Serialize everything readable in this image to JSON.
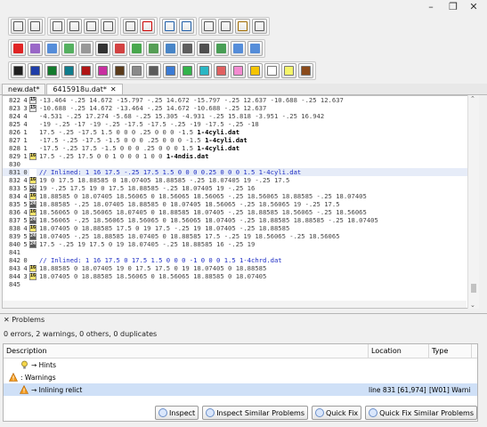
{
  "window": {
    "minimize": "–",
    "maximize": "❐",
    "close": "✕"
  },
  "toolbar": {
    "row1": [
      [
        "icon-new",
        "#555"
      ],
      [
        "icon-mirror",
        "#555"
      ],
      [
        "icon-grid1",
        "#555"
      ],
      [
        "icon-grid2",
        "#555"
      ],
      [
        "icon-grid3",
        "#555"
      ],
      [
        "icon-grid4",
        "#555"
      ],
      [
        "icon-cloud",
        "#555"
      ],
      [
        "icon-block",
        "#c00"
      ],
      [
        "icon-undo",
        "#1e5ea8"
      ],
      [
        "icon-redo",
        "#1e5ea8"
      ],
      [
        "icon-cut",
        "#555"
      ],
      [
        "icon-copy",
        "#555"
      ],
      [
        "icon-paste",
        "#a06b00"
      ],
      [
        "icon-delete",
        "#555"
      ]
    ],
    "row2": [
      [
        "icon-stop",
        "#d00"
      ],
      [
        "icon-edit",
        "#8a4fc0"
      ],
      [
        "icon-colors",
        "#3a7bd5"
      ],
      [
        "icon-puzzle",
        "#3aa546"
      ],
      [
        "icon-gear",
        "#888"
      ],
      [
        "icon-3d",
        "#111"
      ],
      [
        "icon-brick",
        "#c22"
      ],
      [
        "icon-ball",
        "#2a9a30"
      ],
      [
        "icon-rotate",
        "#3a8f3a"
      ],
      [
        "icon-move",
        "#2a72c0"
      ],
      [
        "icon-sync",
        "#444"
      ],
      [
        "icon-dup",
        "#333"
      ],
      [
        "icon-tag",
        "#2a8f3a"
      ],
      [
        "icon-text1",
        "#3a7bd5"
      ],
      [
        "icon-text2",
        "#3a7bd5"
      ]
    ],
    "row3_colors": [
      "#1f1f1f",
      "#1e3da8",
      "#127a2c",
      "#0e7c8c",
      "#b01414",
      "#c82fa0",
      "#5a3a1a",
      "#8a8a8a",
      "#5a5a5a",
      "#3a7bd5",
      "#32b34a",
      "#2ab7c4",
      "#e06060",
      "#f38ad0",
      "#f5c400",
      "#ffffff",
      "#f5f56a",
      "#8a4a1a"
    ]
  },
  "tabs": [
    {
      "label": "new.dat*",
      "active": false,
      "close": ""
    },
    {
      "label": "6415918u.dat*",
      "active": true,
      "close": "✕"
    }
  ],
  "editor": {
    "lines": [
      {
        "num": "822",
        "type": "4",
        "icon": "15",
        "icon_bg": "#e8e8e8",
        "text": "-13.464 -.25 14.672 -15.797 -.25 14.672 -15.797 -.25 12.637 -10.688 -.25 12.637",
        "bold": "",
        "comment": false,
        "current": false
      },
      {
        "num": "823",
        "type": "3",
        "icon": "15",
        "icon_bg": "#e8e8e8",
        "text": "-10.688 -.25 14.672 -13.464 -.25 14.672 -10.688 -.25 12.637",
        "bold": "",
        "comment": false,
        "current": false
      },
      {
        "num": "824",
        "type": "4",
        "icon": "",
        "icon_bg": "#ffffff",
        "text": "-4.531 -.25 17.274 -5.68 -.25 15.305 -4.931 -.25 15.818 -3.951 -.25 16.942",
        "bold": "",
        "comment": false,
        "current": false
      },
      {
        "num": "825",
        "type": "4",
        "icon": "",
        "icon_bg": "#ffffff",
        "text": "-19 -.25 -17 -19 -.25 -17.5 -17.5 -.25 -19 -17.5 -.25 -18",
        "bold": "",
        "comment": false,
        "current": false
      },
      {
        "num": "826",
        "type": "1",
        "icon": "",
        "icon_bg": "#ffffff",
        "text": "17.5 -.25 -17.5 1.5 0 0 0 .25 0 0 0 -1.5 ",
        "bold": "1-4cyli.dat",
        "comment": false,
        "current": false
      },
      {
        "num": "827",
        "type": "1",
        "icon": "",
        "icon_bg": "#ffffff",
        "text": "-17.5 -.25 -17.5 -1.5 0 0 0 .25 0 0 0 -1.5 ",
        "bold": "1-4cyli.dat",
        "comment": false,
        "current": false
      },
      {
        "num": "828",
        "type": "1",
        "icon": "",
        "icon_bg": "#ffffff",
        "text": "-17.5 -.25 17.5 -1.5 0 0 0 .25 0 0 0 1.5 ",
        "bold": "1-4cyli.dat",
        "comment": false,
        "current": false
      },
      {
        "num": "829",
        "type": "1",
        "icon": "16",
        "icon_bg": "#f5e36b",
        "text": "17.5 -.25 17.5 0 0 1 0 0 0 1 0 0 ",
        "bold": "1-4ndis.dat",
        "comment": false,
        "current": false
      },
      {
        "num": "830",
        "type": "",
        "icon": "",
        "icon_bg": "#ffffff",
        "text": "",
        "bold": "",
        "comment": false,
        "current": false
      },
      {
        "num": "831",
        "type": "0",
        "icon": "",
        "icon_bg": "#ffffff",
        "text": "// Inlined: 1 16 17.5 -.25 17.5 1.5 0 0 0 0.25 0 0 0 1.5 1-4cyli.dat",
        "bold": "",
        "comment": true,
        "current": true
      },
      {
        "num": "832",
        "type": "4",
        "icon": "16",
        "icon_bg": "#f5e36b",
        "text": "19 0 17.5 18.88585 0 18.07405 18.88585 -.25 18.07405 19 -.25 17.5",
        "bold": "",
        "comment": false,
        "current": false
      },
      {
        "num": "833",
        "type": "5",
        "icon": "24",
        "icon_bg": "#555555",
        "text": "19 -.25 17.5 19 0 17.5 18.88585 -.25 18.07405 19 -.25 16",
        "bold": "",
        "comment": false,
        "current": false
      },
      {
        "num": "834",
        "type": "4",
        "icon": "16",
        "icon_bg": "#f5e36b",
        "text": "18.88585 0 18.07405 18.56065 0 18.56065 18.56065 -.25 18.56065 18.88585 -.25 18.07405",
        "bold": "",
        "comment": false,
        "current": false
      },
      {
        "num": "835",
        "type": "5",
        "icon": "24",
        "icon_bg": "#555555",
        "text": "18.88585 -.25 18.07405 18.88585 0 18.07405 18.56065 -.25 18.56065 19 -.25 17.5",
        "bold": "",
        "comment": false,
        "current": false
      },
      {
        "num": "836",
        "type": "4",
        "icon": "16",
        "icon_bg": "#f5e36b",
        "text": "18.56065 0 18.56065 18.07405 0 18.88585 18.07405 -.25 18.88585 18.56065 -.25 18.56065",
        "bold": "",
        "comment": false,
        "current": false
      },
      {
        "num": "837",
        "type": "5",
        "icon": "24",
        "icon_bg": "#555555",
        "text": "18.56065 -.25 18.56065 18.56065 0 18.56065 18.07405 -.25 18.88585 18.88585 -.25 18.07405",
        "bold": "",
        "comment": false,
        "current": false
      },
      {
        "num": "838",
        "type": "4",
        "icon": "16",
        "icon_bg": "#f5e36b",
        "text": "18.07405 0 18.88585 17.5 0 19 17.5 -.25 19 18.07405 -.25 18.88585",
        "bold": "",
        "comment": false,
        "current": false
      },
      {
        "num": "839",
        "type": "5",
        "icon": "24",
        "icon_bg": "#555555",
        "text": "18.07405 -.25 18.88585 18.07405 0 18.88585 17.5 -.25 19 18.56065 -.25 18.56065",
        "bold": "",
        "comment": false,
        "current": false
      },
      {
        "num": "840",
        "type": "5",
        "icon": "24",
        "icon_bg": "#555555",
        "text": "17.5 -.25 19 17.5 0 19 18.07405 -.25 18.88585 16 -.25 19",
        "bold": "",
        "comment": false,
        "current": false
      },
      {
        "num": "841",
        "type": "",
        "icon": "",
        "icon_bg": "#ffffff",
        "text": "",
        "bold": "",
        "comment": false,
        "current": false
      },
      {
        "num": "842",
        "type": "0",
        "icon": "",
        "icon_bg": "#ffffff",
        "text": "// Inlined: 1 16 17.5 0 17.5 1.5 0 0 0 -1 0 0 0 1.5 1-4chrd.dat",
        "bold": "",
        "comment": true,
        "current": false
      },
      {
        "num": "843",
        "type": "4",
        "icon": "16",
        "icon_bg": "#f5e36b",
        "text": "18.88585 0 18.07405 19 0 17.5 17.5 0 19 18.07405 0 18.88585",
        "bold": "",
        "comment": false,
        "current": false
      },
      {
        "num": "844",
        "type": "3",
        "icon": "16",
        "icon_bg": "#f5e36b",
        "text": "18.07405 0 18.88585 18.56065 0 18.56065 18.88585 0 18.07405",
        "bold": "",
        "comment": false,
        "current": false
      },
      {
        "num": "845",
        "type": "",
        "icon": "",
        "icon_bg": "#ffffff",
        "text": "",
        "bold": "",
        "comment": false,
        "current": false
      }
    ]
  },
  "problems": {
    "tab_close": "✕",
    "tab_label": "Problems",
    "summary": "0 errors, 2 warnings, 0 others, 0 duplicates",
    "columns": {
      "description": "Description",
      "location": "Location",
      "type": "Type"
    },
    "rows": [
      {
        "kind": "hint",
        "indent": 1,
        "label": "→ Hints",
        "location": "",
        "type": "",
        "selected": false
      },
      {
        "kind": "warning",
        "indent": 0,
        "label": ": Warnings",
        "location": "",
        "type": "",
        "selected": false
      },
      {
        "kind": "warning",
        "indent": 1,
        "label": "→ Inlining relict",
        "location": "line 831   [61,974]",
        "type": "[W01] Warni",
        "selected": true
      }
    ],
    "buttons": [
      "Inspect",
      "Inspect Similar Problems",
      "Quick Fix",
      "Quick Fix Similar Problems"
    ]
  }
}
